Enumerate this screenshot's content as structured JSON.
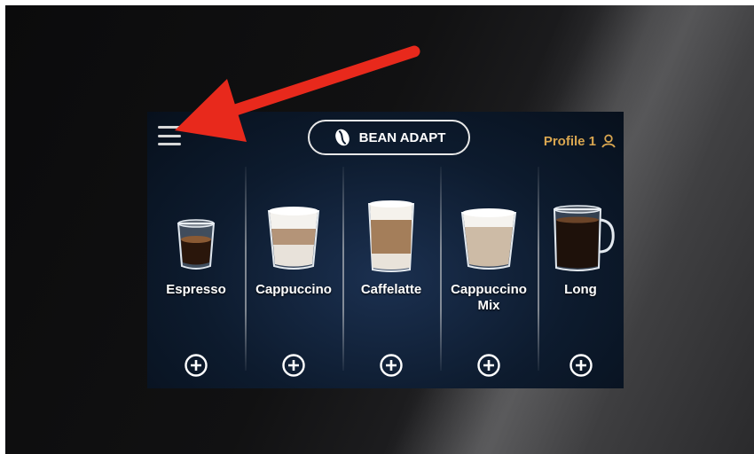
{
  "header": {
    "menu_icon": "hamburger-menu-icon",
    "bean_adapt_label": "BEAN ADAPT",
    "bean_icon": "coffee-bean-icon",
    "profile_label": "Profile 1",
    "profile_icon": "user-icon"
  },
  "drinks": [
    {
      "name": "Espresso"
    },
    {
      "name": "Cappuccino"
    },
    {
      "name": "Caffelatte"
    },
    {
      "name": "Cappuccino Mix"
    },
    {
      "name": "Long"
    }
  ],
  "add_icon": "plus-circle-icon",
  "annotation": {
    "arrow_color": "#e8291c"
  },
  "colors": {
    "screen_bg": "#0d1b2e",
    "profile_accent": "#d9a650",
    "text": "#ffffff"
  }
}
